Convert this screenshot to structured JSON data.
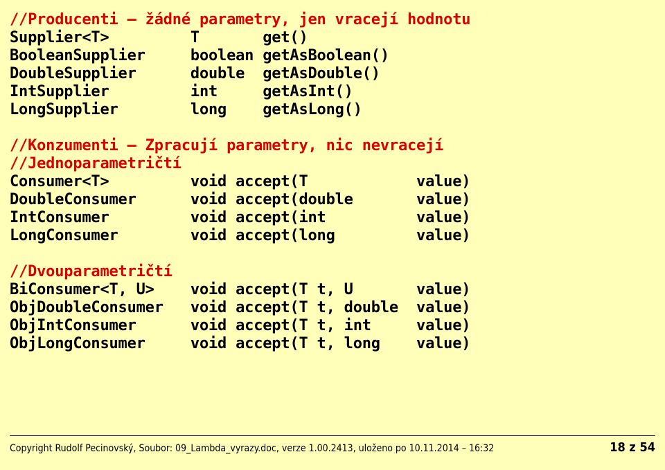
{
  "lines": [
    {
      "red": true,
      "col1": "//Producenti – žádné parametry, jen vracejí hodnotu",
      "col2": "",
      "col3": ""
    },
    {
      "red": false,
      "col1": "Supplier<T>",
      "col2": "T       get()",
      "col3": ""
    },
    {
      "red": false,
      "col1": "BooleanSupplier",
      "col2": "boolean getAsBoolean()",
      "col3": ""
    },
    {
      "red": false,
      "col1": "DoubleSupplier",
      "col2": "double  getAsDouble()",
      "col3": ""
    },
    {
      "red": false,
      "col1": "IntSupplier",
      "col2": "int     getAsInt()",
      "col3": ""
    },
    {
      "red": false,
      "col1": "LongSupplier",
      "col2": "long    getAsLong()",
      "col3": ""
    },
    {
      "blank": true
    },
    {
      "red": true,
      "col1": "//Konzumenti – Zpracují parametry, nic nevracejí",
      "col2": "",
      "col3": ""
    },
    {
      "red": true,
      "col1": "//Jednoparametričtí",
      "col2": "",
      "col3": ""
    },
    {
      "red": false,
      "col1": "Consumer<T>",
      "col2": "void accept(T",
      "col3": "value)"
    },
    {
      "red": false,
      "col1": "DoubleConsumer",
      "col2": "void accept(double",
      "col3": "value)"
    },
    {
      "red": false,
      "col1": "IntConsumer",
      "col2": "void accept(int",
      "col3": "value)"
    },
    {
      "red": false,
      "col1": "LongConsumer",
      "col2": "void accept(long",
      "col3": "value)"
    },
    {
      "blank": true
    },
    {
      "red": true,
      "col1": "//Dvouparametričtí",
      "col2": "",
      "col3": ""
    },
    {
      "red": false,
      "col1": "BiConsumer<T, U>",
      "col2": "void accept(T t, U",
      "col3": "value)"
    },
    {
      "red": false,
      "col1": "ObjDoubleConsumer",
      "col2": "void accept(T t, double",
      "col3": "value)"
    },
    {
      "red": false,
      "col1": "ObjIntConsumer",
      "col2": "void accept(T t, int",
      "col3": "value)"
    },
    {
      "red": false,
      "col1": "ObjLongConsumer",
      "col2": "void accept(T t, long",
      "col3": "value)"
    }
  ],
  "columns": {
    "c1": 20,
    "c2": 25
  },
  "footer": {
    "left": "Copyright Rudolf Pecinovský, Soubor: 09_Lambda_vyrazy.doc, verze 1.00.2413, uloženo po 10.11.2014 – 16:32",
    "right": "18 z 54"
  }
}
